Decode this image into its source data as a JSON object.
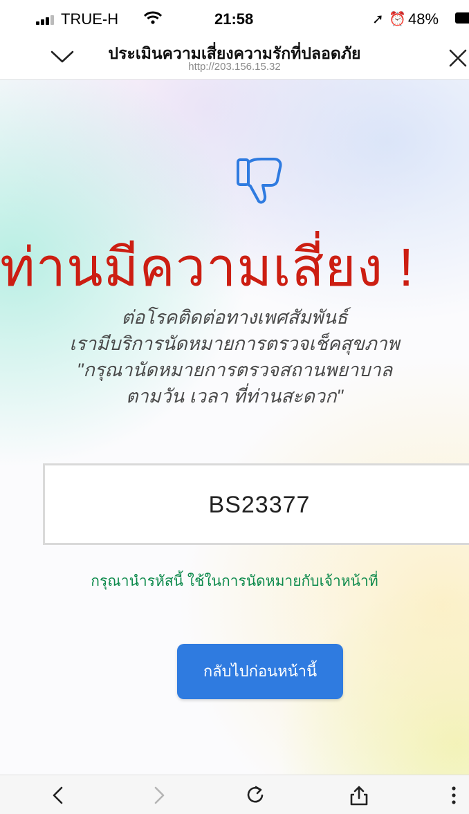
{
  "status_bar": {
    "carrier": "TRUE-H",
    "time": "21:58",
    "battery": "48%",
    "icons": [
      "signal-icon",
      "wifi-icon",
      "location-icon",
      "alarm-icon",
      "battery-icon"
    ]
  },
  "header": {
    "title": "ประเมินความเสี่ยงความรักที่ปลอดภัย",
    "url": "http://203.156.15.32",
    "left_icon": "chevron-down-icon",
    "right_icon": "close-icon"
  },
  "result": {
    "icon": "thumbs-down-icon",
    "headline": "ท่านมีความเสี่ยง !",
    "lines": [
      "ต่อโรคติดต่อทางเพศสัมพันธ์",
      "เรามีบริการนัดหมายการตรวจเช็คสุขภาพ",
      "\"กรุณานัดหมายการตรวจสถานพยาบาล",
      "ตามวัน เวลา ที่ท่านสะดวก\""
    ],
    "code": "BS23377",
    "code_note": "กรุณานำรหัสนี้ ใช้ในการนัดหมายกับเจ้าหน้าที่",
    "back_button": "กลับไปก่อนหน้านี้"
  },
  "toolbar": {
    "icons": [
      "back-icon",
      "forward-icon",
      "reload-icon",
      "share-icon",
      "more-icon"
    ]
  },
  "colors": {
    "headline": "#cc1e12",
    "note": "#0d8a4c",
    "button": "#2f7be0",
    "icon": "#2f7be0"
  }
}
